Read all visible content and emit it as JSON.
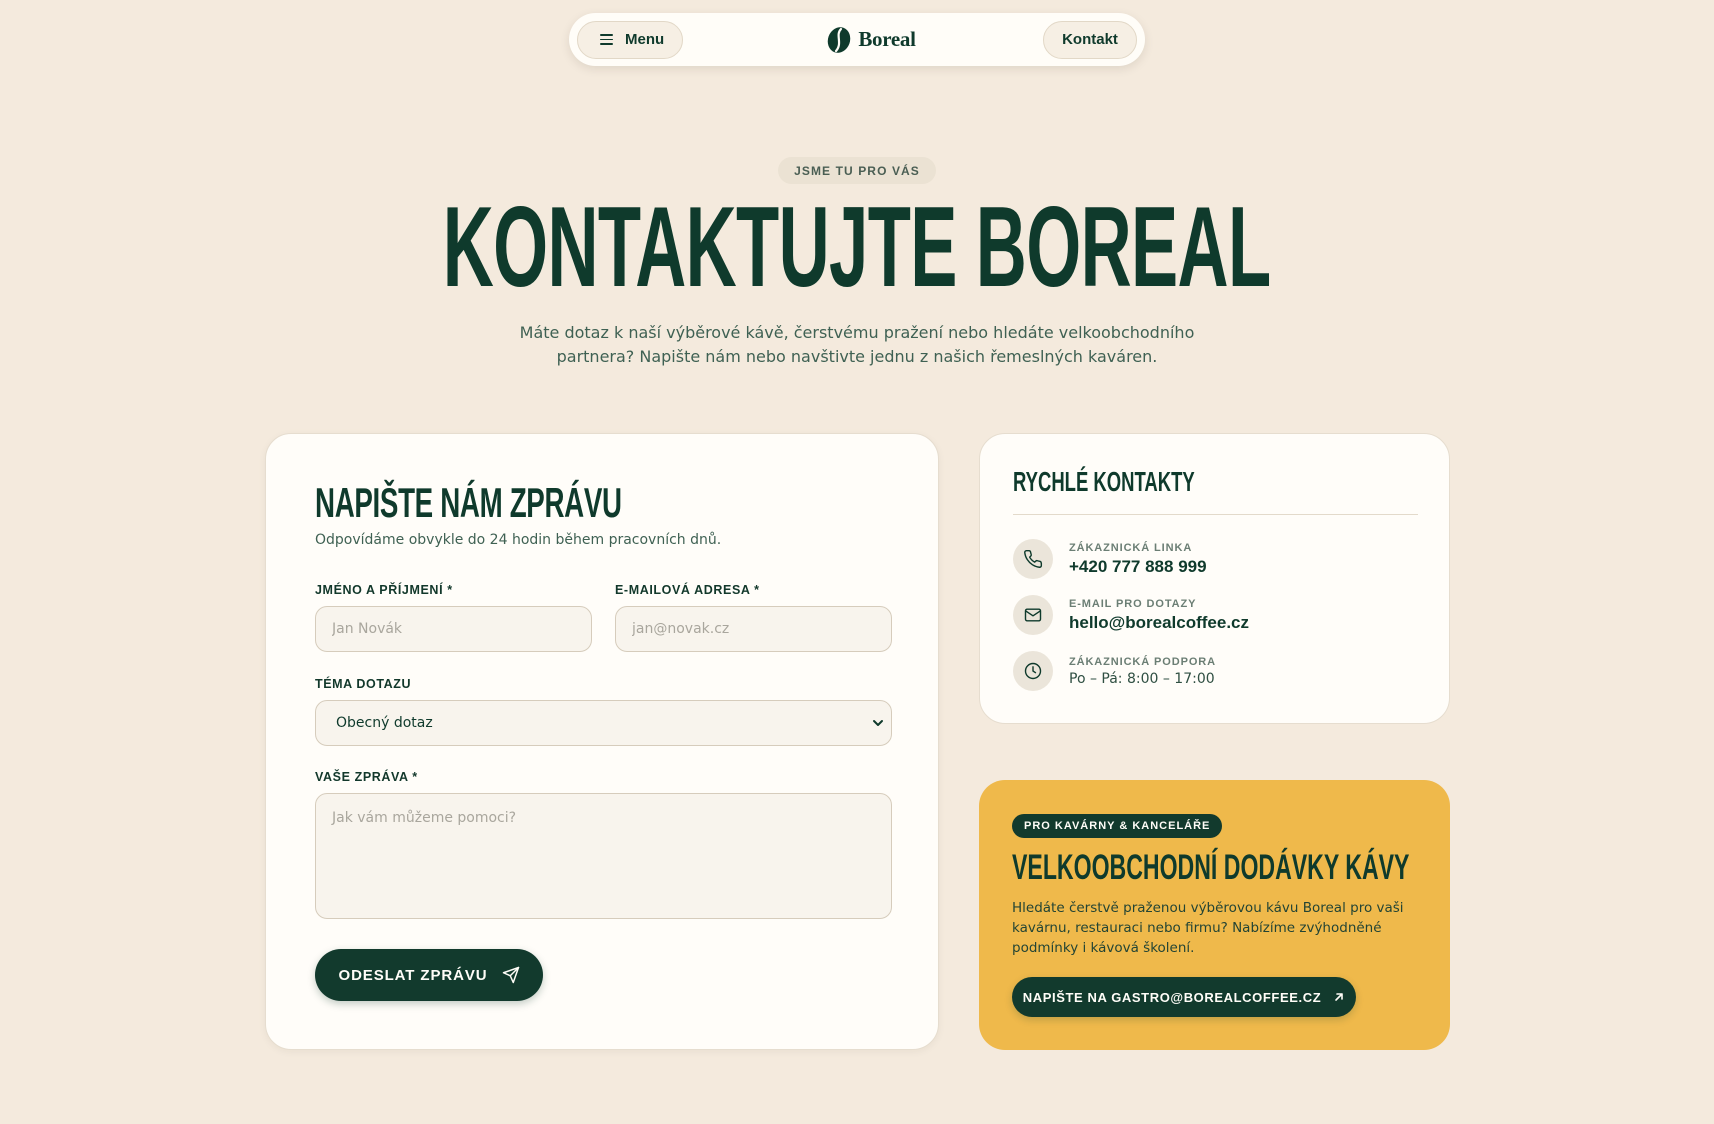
{
  "nav": {
    "menu_label": "Menu",
    "logo_text": "Boreal",
    "contact_label": "Kontakt"
  },
  "hero": {
    "eyebrow": "JSME TU PRO VÁS",
    "title": "KONTAKTUJTE BOREAL",
    "subtitle_line1": "Máte dotaz k naší výběrové kávě, čerstvému pražení nebo hledáte velkoobchodního",
    "subtitle_line2": "partnera? Napište nám nebo navštivte jednu z našich řemeslných kaváren."
  },
  "form": {
    "title": "NAPIŠTE NÁM ZPRÁVU",
    "subtitle": "Odpovídáme obvykle do 24 hodin během pracovních dnů.",
    "name_label": "JMÉNO A PŘÍJMENÍ *",
    "name_placeholder": "Jan Novák",
    "email_label": "E-MAILOVÁ ADRESA *",
    "email_placeholder": "jan@novak.cz",
    "topic_label": "TÉMA DOTAZU",
    "topic_selected": "Obecný dotaz",
    "message_label": "VAŠE ZPRÁVA *",
    "message_placeholder": "Jak vám můžeme pomoci?",
    "submit_label": "ODESLAT ZPRÁVU"
  },
  "quick_contacts": {
    "title": "RYCHLÉ KONTAKTY",
    "items": [
      {
        "label": "ZÁKAZNICKÁ LINKA",
        "value": "+420 777 888 999",
        "icon": "phone-icon"
      },
      {
        "label": "E-MAIL PRO DOTAZY",
        "value": "hello@borealcoffee.cz",
        "icon": "mail-icon"
      },
      {
        "label": "ZÁKAZNICKÁ PODPORA",
        "value": "Po – Pá: 8:00 – 17:00",
        "icon": "clock-icon"
      }
    ]
  },
  "wholesale": {
    "badge": "PRO KAVÁRNY & KANCELÁŘE",
    "title": "VELKOOBCHODNÍ DODÁVKY KÁVY",
    "text": "Hledáte čerstvě praženou výběrovou kávu Boreal pro vaši kavárnu, restauraci nebo firmu? Nabízíme zvýhodněné podmínky i kávová školení.",
    "button_label": "NAPIŠTE NA GASTRO@BOREALCOFFEE.CZ"
  },
  "colors": {
    "background": "#f4eadd",
    "brand_green": "#123a2d",
    "accent_yellow": "#efb94b",
    "card": "#fffdf9"
  }
}
